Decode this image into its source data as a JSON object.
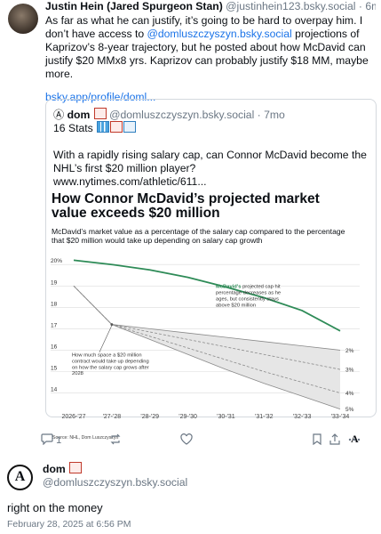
{
  "post": {
    "author_name": "Justin Hein (Jared Spurgeon Stan)",
    "author_handle": "@justinhein123.bsky.social",
    "age": "6mo",
    "text_before_mention": "As far as what he can justify, it’s going to be hard to overpay him. I don’t have access to ",
    "mention": "@domluszczyszyn.bsky.social",
    "text_after_mention": " projections of Kaprizov’s 8-year trajectory, but he posted about how McDavid can justify $20 MMx8 yrs. Kaprizov can probably justify $18 MM, maybe more.",
    "link": "bsky.app/profile/doml..."
  },
  "quote": {
    "author_name": "dom",
    "author_handle": "@domluszczyszyn.bsky.social",
    "age": "7mo",
    "stats": "16 Stats",
    "text": "With a rapidly rising salary cap, can Connor McDavid become the NHL’s first $20 million player?",
    "url": "www.nytimes.com/athletic/611..."
  },
  "chart_data": {
    "type": "line",
    "title": "How Connor McDavid’s projected market value exceeds $20 million",
    "subtitle": "McDavid’s market value as a percentage of the salary cap compared to the percentage that $20 million would take up depending on salary cap growth",
    "x": [
      "2026-'27",
      "'27-'28",
      "'28-'29",
      "'29-'30",
      "'30-'31",
      "'31-'32",
      "'32-'33",
      "'33-'34"
    ],
    "y_ticks": [
      "20%",
      "19",
      "18",
      "17",
      "16",
      "15",
      "14"
    ],
    "ylim": [
      13.4,
      20.3
    ],
    "series": [
      {
        "name": "McDavid's",
        "color": "#2e8b57",
        "values": [
          20.2,
          20.0,
          19.75,
          19.4,
          18.95,
          18.45,
          17.85,
          16.9
        ]
      },
      {
        "growth": "2%",
        "values": [
          19.0,
          17.2,
          17.0,
          16.8,
          16.6,
          16.4,
          16.2,
          16.0
        ]
      },
      {
        "growth": "3%",
        "values": [
          19.0,
          17.2,
          16.85,
          16.5,
          16.15,
          15.8,
          15.45,
          15.1
        ]
      },
      {
        "growth": "4%",
        "values": [
          19.0,
          17.2,
          16.65,
          16.1,
          15.55,
          15.0,
          14.5,
          14.0
        ]
      },
      {
        "growth": "5%",
        "values": [
          19.0,
          17.2,
          16.5,
          15.8,
          15.1,
          14.45,
          13.85,
          13.25
        ]
      }
    ],
    "series_labels": [
      "2%",
      "3%",
      "4%",
      "5%"
    ],
    "annotation_green_name": "McDavid's",
    "annotation_green": " projected cap hit percentage decreases as he ages, but consistently stays above $20 million",
    "annotation_grey": "How much space a $20 million contract would take up depending on how the salary cap grows after 2028",
    "source": "Source: NHL, Dom Luszczyszyn",
    "logo": "A"
  },
  "actions": {
    "replies": "1"
  },
  "reply": {
    "author_name": "dom",
    "author_handle": "@domluszczyszyn.bsky.social",
    "avatar_letter": "A",
    "text": "right on the money",
    "date": "February 28, 2025 at 6:56 PM"
  },
  "colors": {
    "accent": "#1a73e8",
    "green_line": "#2e8b57",
    "muted": "#6b7784"
  }
}
